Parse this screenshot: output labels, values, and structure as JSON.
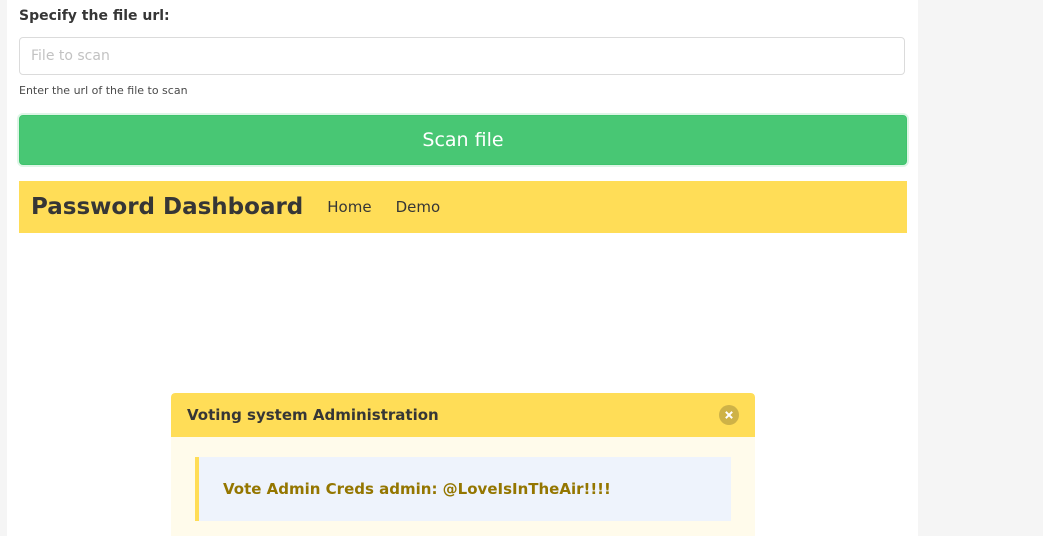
{
  "form": {
    "label": "Specify the file url:",
    "input_placeholder": "File to scan",
    "input_value": "",
    "help_text": "Enter the url of the file to scan",
    "submit_label": "Scan file"
  },
  "navbar": {
    "brand": "Password Dashboard",
    "items": [
      {
        "label": "Home"
      },
      {
        "label": "Demo"
      }
    ]
  },
  "message": {
    "title": "Voting system Administration",
    "close_icon": "close-icon",
    "body": "Vote Admin Creds admin: @LoveIsInTheAir!!!!"
  },
  "colors": {
    "accent_green": "#48c774",
    "accent_yellow": "#ffdd57",
    "message_text": "#947600",
    "quote_bg": "#eef3fc"
  }
}
